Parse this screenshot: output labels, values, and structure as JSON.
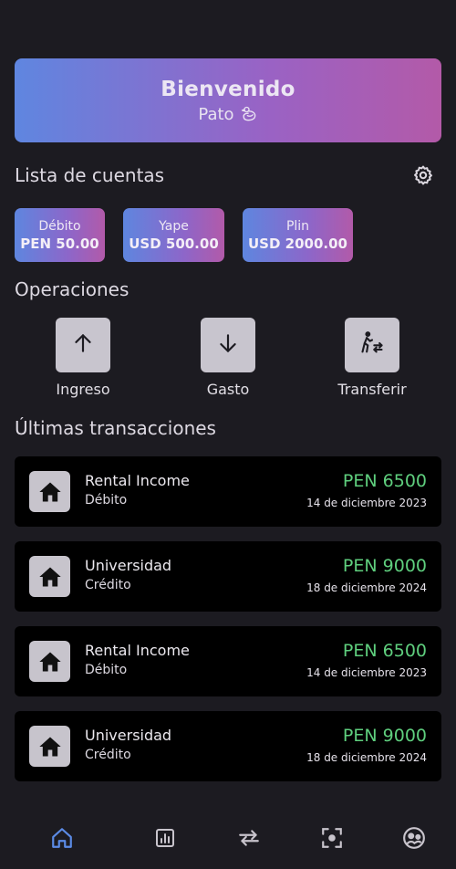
{
  "banner": {
    "title": "Bienvenido",
    "user": "Pato",
    "user_icon": "duck-icon"
  },
  "accounts": {
    "title": "Lista de cuentas",
    "settings_icon": "gear-icon",
    "items": [
      {
        "name": "Débito",
        "amount": "PEN 50.00"
      },
      {
        "name": "Yape",
        "amount": "USD 500.00"
      },
      {
        "name": "Plin",
        "amount": "USD 2000.00"
      }
    ]
  },
  "operations": {
    "title": "Operaciones",
    "items": [
      {
        "label": "Ingreso",
        "icon": "arrow-up-icon"
      },
      {
        "label": "Gasto",
        "icon": "arrow-down-icon"
      },
      {
        "label": "Transferir",
        "icon": "transfer-walk-icon"
      }
    ]
  },
  "transactions": {
    "title": "Últimas transacciones",
    "items": [
      {
        "title": "Rental Income",
        "account": "Débito",
        "amount": "PEN 6500",
        "date": "14 de diciembre 2023",
        "icon": "home-icon"
      },
      {
        "title": "Universidad",
        "account": "Crédito",
        "amount": "PEN 9000",
        "date": "18 de diciembre 2024",
        "icon": "home-icon"
      },
      {
        "title": "Rental Income",
        "account": "Débito",
        "amount": "PEN 6500",
        "date": "14 de diciembre 2023",
        "icon": "home-icon"
      },
      {
        "title": "Universidad",
        "account": "Crédito",
        "amount": "PEN 9000",
        "date": "18 de diciembre 2024",
        "icon": "home-icon"
      }
    ]
  },
  "nav": {
    "items": [
      "home-icon",
      "chart-icon",
      "swap-icon",
      "scan-icon",
      "profile-icon"
    ],
    "active": "home-icon",
    "active_color": "#5b8be6"
  },
  "colors": {
    "positive_amount": "#5fcf7e",
    "card_gradient_start": "#5e86df",
    "card_gradient_end": "#b25aa9"
  }
}
